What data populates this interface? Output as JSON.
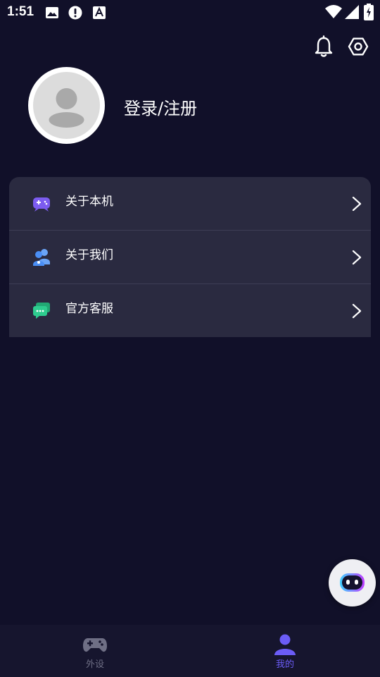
{
  "status_bar": {
    "time": "1:51",
    "left_icons": [
      "image-icon",
      "alert-icon",
      "font-icon"
    ],
    "right_icons": [
      "wifi-icon",
      "signal-icon",
      "battery-icon"
    ]
  },
  "header": {
    "icons": [
      "bell-icon",
      "settings-icon"
    ]
  },
  "profile": {
    "login_label": "登录/注册"
  },
  "menu": {
    "items": [
      {
        "label": "关于本机",
        "icon": "gamepad-icon",
        "color": "#7c5cf0"
      },
      {
        "label": "关于我们",
        "icon": "users-icon",
        "color": "#4a8ef5"
      },
      {
        "label": "官方客服",
        "icon": "chat-icon",
        "color": "#2ecc8f"
      }
    ]
  },
  "bottom_nav": {
    "tabs": [
      {
        "label": "外设",
        "icon": "controller-icon",
        "active": false
      },
      {
        "label": "我的",
        "icon": "person-icon",
        "active": true
      }
    ],
    "active_color": "#6b5cf6",
    "inactive_color": "#6f6f85"
  },
  "colors": {
    "background": "#111029",
    "card": "#2a2a40",
    "accent": "#6b5cf6"
  }
}
